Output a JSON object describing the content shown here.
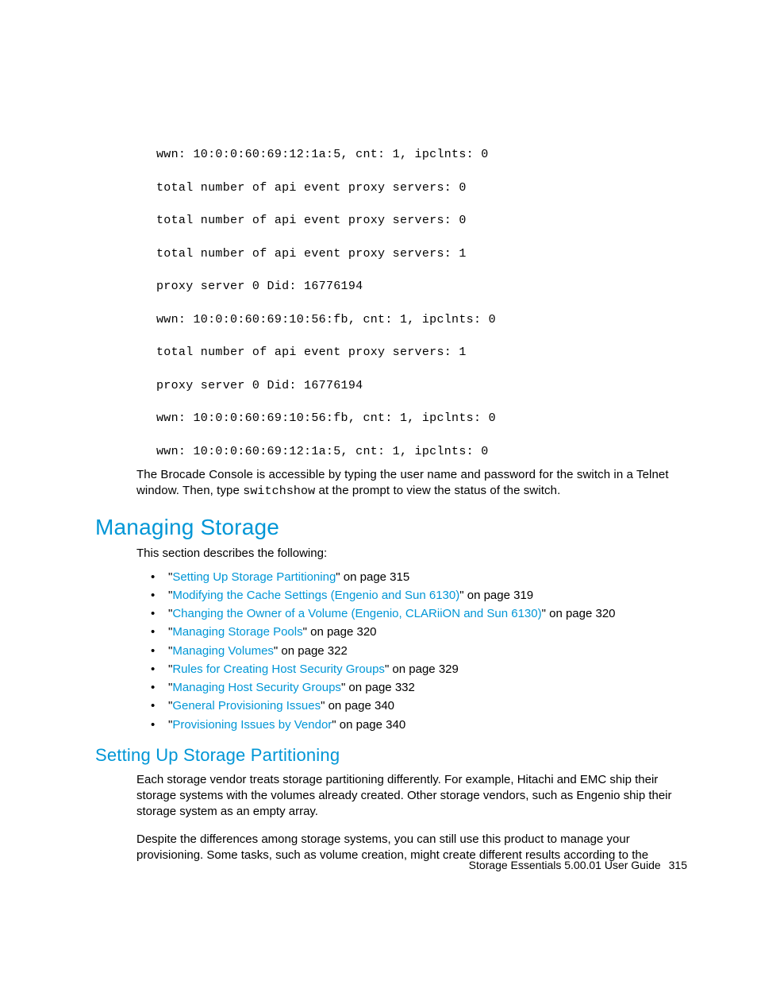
{
  "mono": {
    "l1": "wwn: 10:0:0:60:69:12:1a:5, cnt: 1, ipclnts: 0",
    "l2": "total number of api event proxy servers: 0",
    "l3": "total number of api event proxy servers: 0",
    "l4": "total number of api event proxy servers: 1",
    "l5": "proxy server 0 Did: 16776194",
    "l6": "wwn: 10:0:0:60:69:10:56:fb, cnt: 1, ipclnts: 0",
    "l7": "total number of api event proxy servers: 1",
    "l8": "proxy server 0 Did: 16776194",
    "l9": "wwn: 10:0:0:60:69:10:56:fb, cnt: 1, ipclnts: 0",
    "l10": "wwn: 10:0:0:60:69:12:1a:5, cnt: 1, ipclnts: 0"
  },
  "para_console_a": "The Brocade Console is accessible by typing the user name and password for the switch in a Telnet window. Then, type ",
  "para_console_cmd": "switchshow",
  "para_console_b": " at the prompt to view the status of the switch.",
  "h1": "Managing Storage",
  "intro": "This section describes the following:",
  "links": [
    {
      "text": "Setting Up Storage Partitioning",
      "suffix": "\" on page 315"
    },
    {
      "text": "Modifying the Cache Settings (Engenio and Sun 6130)",
      "suffix": "\" on page 319"
    },
    {
      "text": "Changing the Owner of a Volume (Engenio, CLARiiON and Sun 6130)",
      "suffix": "\" on page 320"
    },
    {
      "text": "Managing Storage Pools",
      "suffix": "\" on page 320"
    },
    {
      "text": "Managing Volumes",
      "suffix": "\" on page 322"
    },
    {
      "text": "Rules for Creating Host Security Groups",
      "suffix": "\" on page 329"
    },
    {
      "text": "Managing Host Security Groups",
      "suffix": "\" on page 332"
    },
    {
      "text": "General Provisioning Issues",
      "suffix": "\" on page 340"
    },
    {
      "text": "Provisioning Issues by Vendor",
      "suffix": "\" on page 340"
    }
  ],
  "quote_open": "\"",
  "h2": "Setting Up Storage Partitioning",
  "p1": "Each storage vendor treats storage partitioning differently. For example, Hitachi and EMC ship their storage systems with the volumes already created. Other storage vendors, such as Engenio ship their storage system as an empty array.",
  "p2": "Despite the differences among storage systems, you can still use this product to manage your provisioning. Some tasks, such as volume creation, might create different results according to the",
  "footer": {
    "title": "Storage Essentials 5.00.01 User Guide",
    "page": "315"
  }
}
